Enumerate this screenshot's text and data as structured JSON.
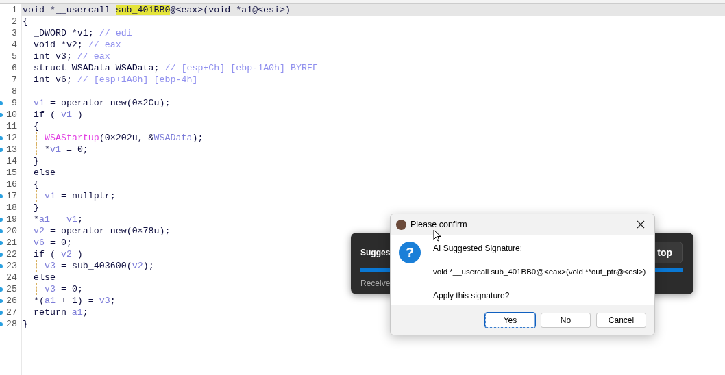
{
  "code_lines": [
    {
      "number": "1",
      "selected": true,
      "breakpoint": false,
      "tokens": [
        {
          "kind": "code",
          "text": "void *__usercall "
        },
        {
          "kind": "highlight",
          "text": "sub_401BB0"
        },
        {
          "kind": "code",
          "text": "@<eax>(void *a1@<esi>)"
        }
      ]
    },
    {
      "number": "2",
      "selected": false,
      "breakpoint": false,
      "tokens": [
        {
          "kind": "code",
          "text": "{"
        }
      ],
      "children": [
        {
          "number": "3",
          "selected": false,
          "breakpoint": false,
          "tokens": [
            {
              "kind": "code",
              "text": "_DWORD *v1; "
            },
            {
              "kind": "comment",
              "text": "// edi"
            }
          ]
        },
        {
          "number": "4",
          "selected": false,
          "breakpoint": false,
          "tokens": [
            {
              "kind": "code",
              "text": "void *v2; "
            },
            {
              "kind": "comment",
              "text": "// eax"
            }
          ]
        },
        {
          "number": "5",
          "selected": false,
          "breakpoint": false,
          "tokens": [
            {
              "kind": "code",
              "text": "int v3; "
            },
            {
              "kind": "comment",
              "text": "// eax"
            }
          ]
        },
        {
          "number": "6",
          "selected": false,
          "breakpoint": false,
          "tokens": [
            {
              "kind": "code",
              "text": "struct WSAData WSAData; "
            },
            {
              "kind": "comment",
              "text": "// [esp+Ch] [ebp-1A0h] BYREF"
            }
          ]
        },
        {
          "number": "7",
          "selected": false,
          "breakpoint": false,
          "tokens": [
            {
              "kind": "code",
              "text": "int v6; "
            },
            {
              "kind": "comment",
              "text": "// [esp+1A8h] [ebp-4h]"
            }
          ]
        },
        {
          "number": "8",
          "selected": false,
          "breakpoint": false
        },
        {
          "number": "9",
          "selected": false,
          "breakpoint": true,
          "tokens": [
            {
              "kind": "var",
              "text": "v1"
            },
            {
              "kind": "code",
              "text": " = operator new(0×2Cu);"
            }
          ]
        },
        {
          "number": "10",
          "selected": false,
          "breakpoint": true,
          "tokens": [
            {
              "kind": "code",
              "text": "if ( "
            },
            {
              "kind": "var",
              "text": "v1"
            },
            {
              "kind": "code",
              "text": " )"
            }
          ]
        },
        {
          "number": "11",
          "selected": false,
          "breakpoint": false,
          "tokens": [
            {
              "kind": "code",
              "text": "{"
            }
          ],
          "children": [
            {
              "number": "12",
              "selected": false,
              "breakpoint": true,
              "tokens": [
                {
                  "kind": "import",
                  "text": "WSAStartup"
                },
                {
                  "kind": "code",
                  "text": "(0×202u, &"
                },
                {
                  "kind": "var",
                  "text": "WSAData"
                },
                {
                  "kind": "code",
                  "text": ");"
                }
              ]
            },
            {
              "number": "13",
              "selected": false,
              "breakpoint": true,
              "tokens": [
                {
                  "kind": "code",
                  "text": "*"
                },
                {
                  "kind": "var",
                  "text": "v1"
                },
                {
                  "kind": "code",
                  "text": " = 0;"
                }
              ]
            }
          ]
        },
        {
          "number": "14",
          "selected": false,
          "breakpoint": false,
          "tokens": [
            {
              "kind": "code",
              "text": "}"
            }
          ]
        },
        {
          "number": "15",
          "selected": false,
          "breakpoint": false,
          "tokens": [
            {
              "kind": "code",
              "text": "else"
            }
          ]
        },
        {
          "number": "16",
          "selected": false,
          "breakpoint": false,
          "tokens": [
            {
              "kind": "code",
              "text": "{"
            }
          ],
          "children": [
            {
              "number": "17",
              "selected": false,
              "breakpoint": true,
              "tokens": [
                {
                  "kind": "var",
                  "text": "v1"
                },
                {
                  "kind": "code",
                  "text": " = nullptr;"
                }
              ]
            }
          ]
        },
        {
          "number": "18",
          "selected": false,
          "breakpoint": false,
          "tokens": [
            {
              "kind": "code",
              "text": "}"
            }
          ]
        },
        {
          "number": "19",
          "selected": false,
          "breakpoint": true,
          "tokens": [
            {
              "kind": "code",
              "text": "*"
            },
            {
              "kind": "var",
              "text": "a1"
            },
            {
              "kind": "code",
              "text": " = "
            },
            {
              "kind": "var",
              "text": "v1"
            },
            {
              "kind": "code",
              "text": ";"
            }
          ]
        },
        {
          "number": "20",
          "selected": false,
          "breakpoint": true,
          "tokens": [
            {
              "kind": "var",
              "text": "v2"
            },
            {
              "kind": "code",
              "text": " = operator new(0×78u);"
            }
          ]
        },
        {
          "number": "21",
          "selected": false,
          "breakpoint": true,
          "tokens": [
            {
              "kind": "var",
              "text": "v6"
            },
            {
              "kind": "code",
              "text": " = 0;"
            }
          ]
        },
        {
          "number": "22",
          "selected": false,
          "breakpoint": true,
          "tokens": [
            {
              "kind": "code",
              "text": "if ( "
            },
            {
              "kind": "var",
              "text": "v2"
            },
            {
              "kind": "code",
              "text": " )"
            }
          ],
          "children": [
            {
              "number": "23",
              "selected": false,
              "breakpoint": true,
              "tokens": [
                {
                  "kind": "var",
                  "text": "v3"
                },
                {
                  "kind": "code",
                  "text": " = sub_403600("
                },
                {
                  "kind": "var",
                  "text": "v2"
                },
                {
                  "kind": "code",
                  "text": ");"
                }
              ]
            }
          ]
        },
        {
          "number": "24",
          "selected": false,
          "breakpoint": false,
          "tokens": [
            {
              "kind": "code",
              "text": "else"
            }
          ],
          "children": [
            {
              "number": "25",
              "selected": false,
              "breakpoint": true,
              "tokens": [
                {
                  "kind": "var",
                  "text": "v3"
                },
                {
                  "kind": "code",
                  "text": " = 0;"
                }
              ]
            }
          ]
        },
        {
          "number": "26",
          "selected": false,
          "breakpoint": true,
          "tokens": [
            {
              "kind": "code",
              "text": "*("
            },
            {
              "kind": "var",
              "text": "a1"
            },
            {
              "kind": "code",
              "text": " + 1) = "
            },
            {
              "kind": "var",
              "text": "v3"
            },
            {
              "kind": "code",
              "text": ";"
            }
          ]
        },
        {
          "number": "27",
          "selected": false,
          "breakpoint": true,
          "tokens": [
            {
              "kind": "code",
              "text": "return "
            },
            {
              "kind": "var",
              "text": "a1"
            },
            {
              "kind": "code",
              "text": ";"
            }
          ]
        }
      ]
    },
    {
      "number": "28",
      "selected": false,
      "breakpoint": true,
      "tokens": [
        {
          "kind": "code",
          "text": "}"
        }
      ]
    }
  ],
  "toast": {
    "title": "Sugges",
    "button": "top",
    "status": "Receive",
    "level": 1
  },
  "dialog": {
    "title": "Please confirm",
    "icon": "?",
    "heading": "AI Suggested Signature:",
    "signature": "void *__usercall sub_401BB0@<eax>(void **out_ptr@<esi>)",
    "question": "Apply this signature?",
    "buttons": [
      {
        "label": "Yes",
        "selected": true
      },
      {
        "label": "No",
        "selected": false
      },
      {
        "label": "Cancel",
        "selected": false
      }
    ]
  }
}
